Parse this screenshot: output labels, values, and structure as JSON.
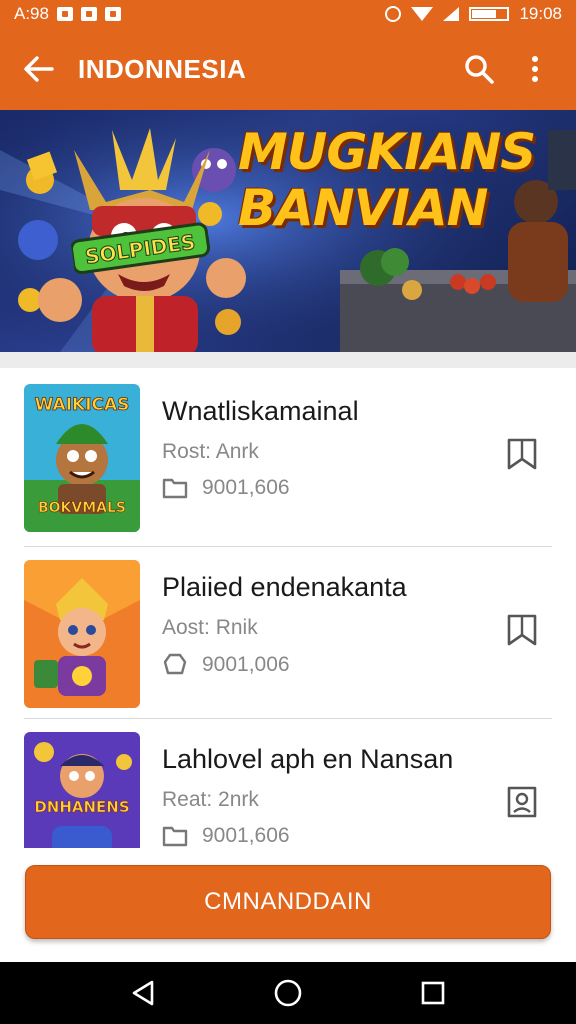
{
  "status_bar": {
    "time_left": "A:98",
    "time_right": "19:08"
  },
  "app_bar": {
    "title": "INDONNESIA",
    "icons": [
      "back-arrow-icon",
      "search-icon",
      "more-vert-icon"
    ]
  },
  "banner": {
    "headline_line1": "MUGKIANS",
    "headline_line2": "BANVIAN",
    "sticker_text": "SOLPIDES"
  },
  "list": {
    "items": [
      {
        "thumb_text_top": "WAIKICAS",
        "thumb_text_bottom": "BOKVMALS",
        "title": "Wnatliskamainal",
        "subtitle": "Rost: Anrk",
        "meta_icon": "folder-icon",
        "meta_value": "9001,606",
        "action_icon": "bookmark-icon"
      },
      {
        "title": "Plaiied endenakanta",
        "subtitle": "Aost: Rnik",
        "meta_icon": "shield-icon",
        "meta_value": "9001,006",
        "action_icon": "bookmark-icon"
      },
      {
        "thumb_text_top": "DNHANENS",
        "title": "Lahlovel aph en Nansan",
        "subtitle": "Reat: 2nrk",
        "meta_icon": "folder-icon",
        "meta_value": "9001,606",
        "action_icon": "badge-icon"
      }
    ]
  },
  "cta": {
    "label": "CMNANDDAIN"
  },
  "nav_bar": {
    "icons": [
      "back-triangle-icon",
      "home-circle-icon",
      "recents-square-icon"
    ]
  },
  "colors": {
    "accent": "#e2661c",
    "headline": "#ffc21a",
    "text_primary": "#1a1a1a",
    "text_secondary": "#888888"
  }
}
